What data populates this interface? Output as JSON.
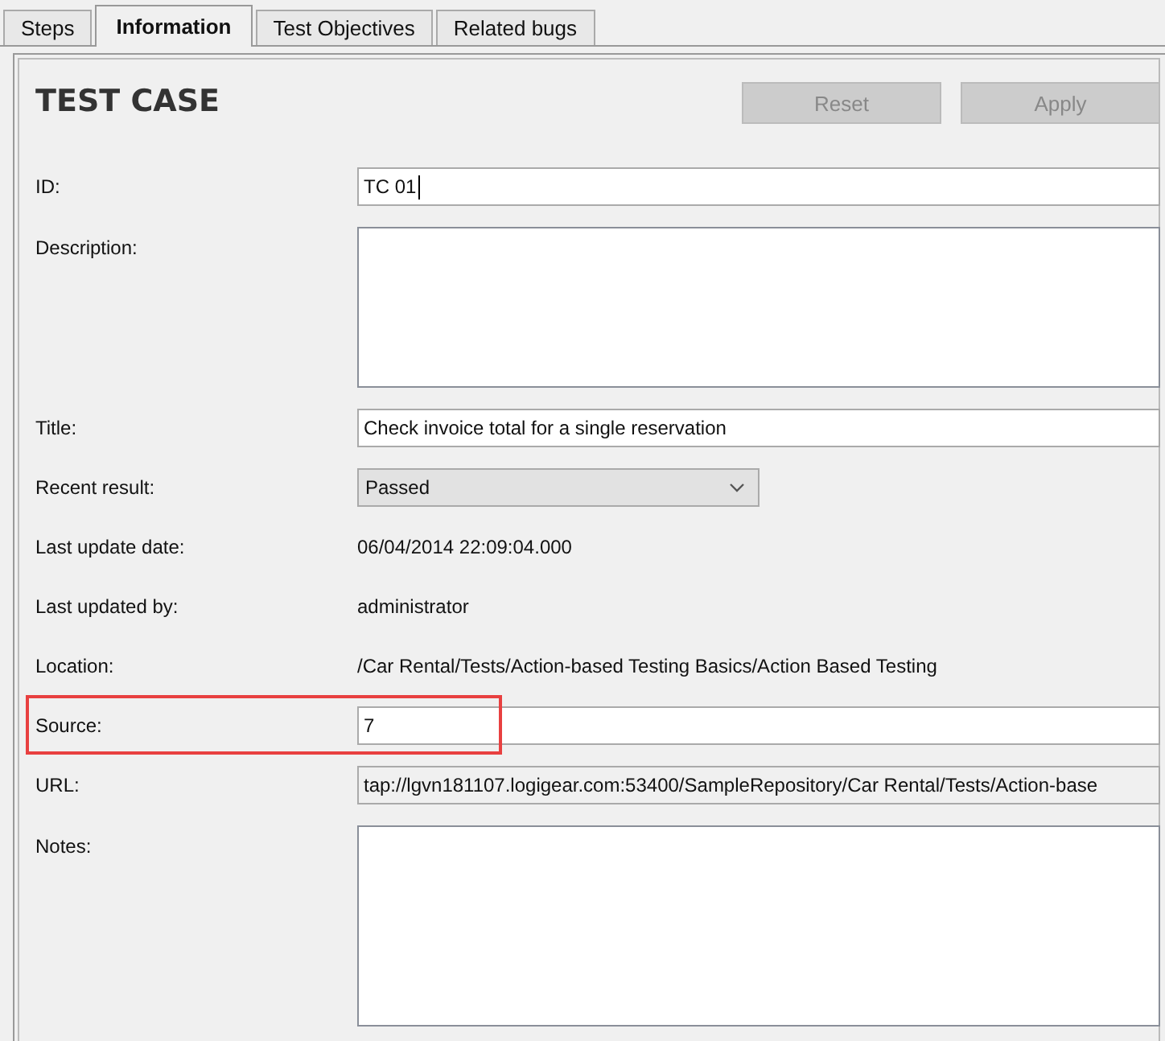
{
  "tabs": [
    {
      "label": "Steps",
      "selected": false
    },
    {
      "label": "Information",
      "selected": true
    },
    {
      "label": "Test Objectives",
      "selected": false
    },
    {
      "label": "Related bugs",
      "selected": false
    }
  ],
  "heading": "TEST CASE",
  "buttons": [
    {
      "label": "Reset",
      "disabled": true
    },
    {
      "label": "Apply",
      "disabled": true
    }
  ],
  "fields": [
    {
      "kind": "input",
      "label": "ID:",
      "value": "TC 01",
      "caret": true,
      "highlighted": false
    },
    {
      "kind": "textarea",
      "label": "Description:",
      "highlighted": false
    },
    {
      "kind": "input",
      "label": "Title:",
      "value": "Check invoice total for a single reservation",
      "highlighted": false
    },
    {
      "kind": "select",
      "label": "Recent result:",
      "value": "Passed",
      "highlighted": false
    },
    {
      "kind": "text",
      "label": "Last update date:",
      "value": "06/04/2014 22:09:04.000",
      "highlighted": false
    },
    {
      "kind": "text",
      "label": "Last updated by:",
      "value": "administrator",
      "highlighted": false
    },
    {
      "kind": "text",
      "label": "Location:",
      "value": "/Car Rental/Tests/Action-based Testing Basics/Action Based Testing",
      "highlighted": false
    },
    {
      "kind": "input",
      "label": "Source:",
      "value": "7",
      "highlighted": true
    },
    {
      "kind": "readonly",
      "label": "URL:",
      "value": "tap://lgvn181107.logigear.com:53400/SampleRepository/Car Rental/Tests/Action-base",
      "highlighted": false
    },
    {
      "kind": "textarea",
      "label": "Notes:",
      "highlighted": false
    }
  ]
}
